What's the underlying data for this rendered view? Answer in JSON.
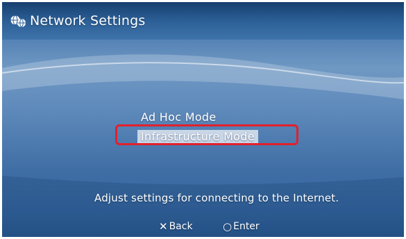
{
  "header": {
    "title": "Network Settings",
    "icon": "network-globe-icon"
  },
  "menu": {
    "items": [
      {
        "label": "Ad Hoc Mode",
        "selected": false
      },
      {
        "label": "Infrastructure Mode",
        "selected": true
      }
    ]
  },
  "help": {
    "text": "Adjust settings for connecting to the Internet."
  },
  "controls": {
    "back_glyph": "✕",
    "back_label": "Back",
    "enter_glyph": "○",
    "enter_label": "Enter"
  },
  "colors": {
    "background": "#5f8abb",
    "selection_fill": "#c9d6e6",
    "annotation_outline": "#e3202b",
    "text": "#ffffff"
  }
}
